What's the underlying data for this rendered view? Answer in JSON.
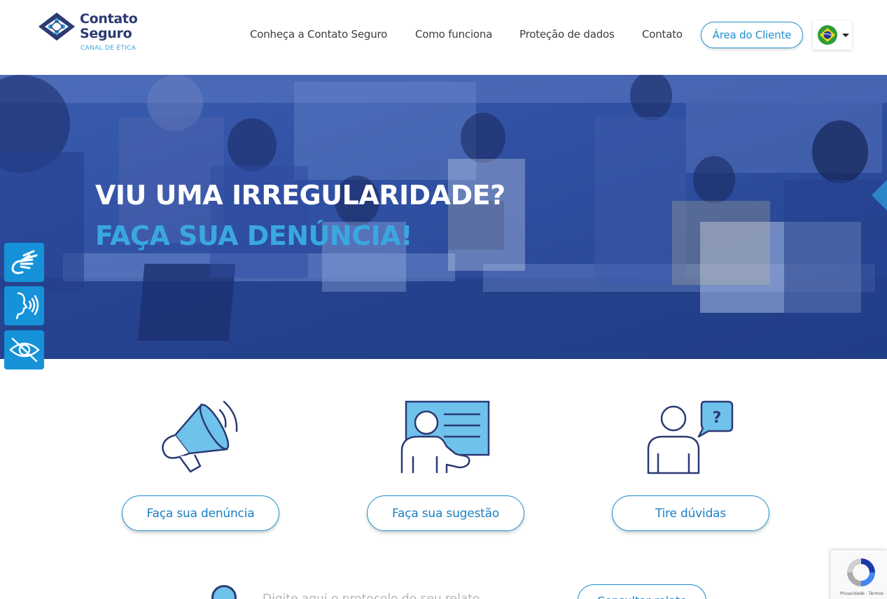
{
  "brand": {
    "name_line1": "Contato",
    "name_line2": "Seguro",
    "tagline": "CANAL DE ÉTICA",
    "primary_color": "#2b3a73",
    "accent_color": "#1e8fd0",
    "light_accent": "#3aa8e0"
  },
  "nav": {
    "items": [
      {
        "label": "Conheça a Contato Seguro"
      },
      {
        "label": "Como funciona"
      },
      {
        "label": "Proteção de dados"
      },
      {
        "label": "Contato"
      }
    ],
    "client_area": "Área do Cliente",
    "language_flag": "brazil-flag-icon"
  },
  "hero": {
    "title": "VIU UMA IRREGULARIDADE?",
    "subtitle": "FAÇA SUA DENÚNCIA!"
  },
  "accessibility": [
    {
      "icon": "sign-language-icon"
    },
    {
      "icon": "speech-icon"
    },
    {
      "icon": "hidden-eye-icon"
    }
  ],
  "cards": [
    {
      "icon": "megaphone-icon",
      "label": "Faça sua denúncia"
    },
    {
      "icon": "presentation-icon",
      "label": "Faça sua sugestão"
    },
    {
      "icon": "question-person-icon",
      "label": "Tire dúvidas"
    }
  ],
  "protocol": {
    "placeholder": "Digite aqui o protocolo do seu relato",
    "button": "Consultar relato"
  },
  "recaptcha": {
    "privacy": "Privacidade",
    "terms": "Termos"
  }
}
